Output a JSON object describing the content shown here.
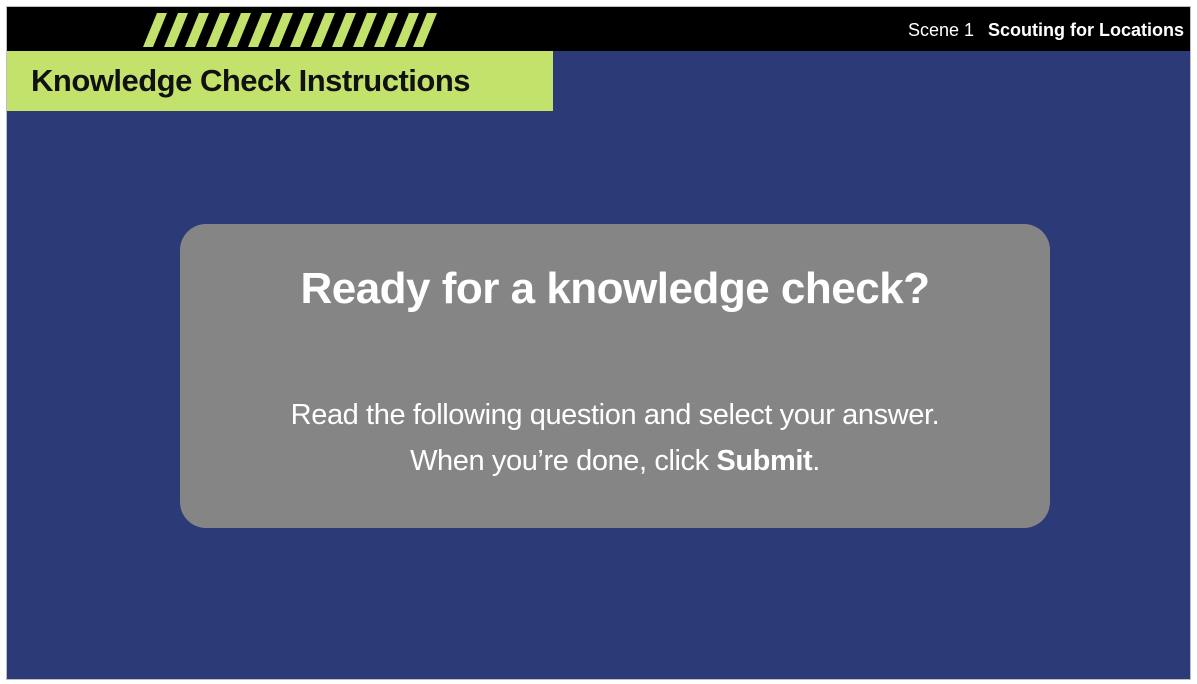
{
  "header": {
    "scene_label": "Scene 1",
    "scene_title": "Scouting for Locations"
  },
  "title_tab": {
    "text": "Knowledge Check Instructions"
  },
  "card": {
    "heading": "Ready for a knowledge check?",
    "line1": "Read the following question and select your answer.",
    "line2_prefix": "When you’re done, click ",
    "line2_action": "Submit",
    "line2_suffix": "."
  },
  "colors": {
    "background": "#2c3a78",
    "topbar": "#000000",
    "accent": "#c3e26b",
    "card": "#858585",
    "text_light": "#ffffff",
    "text_dark": "#111111"
  },
  "icons": {
    "decor": "hazard-stripes-icon"
  }
}
